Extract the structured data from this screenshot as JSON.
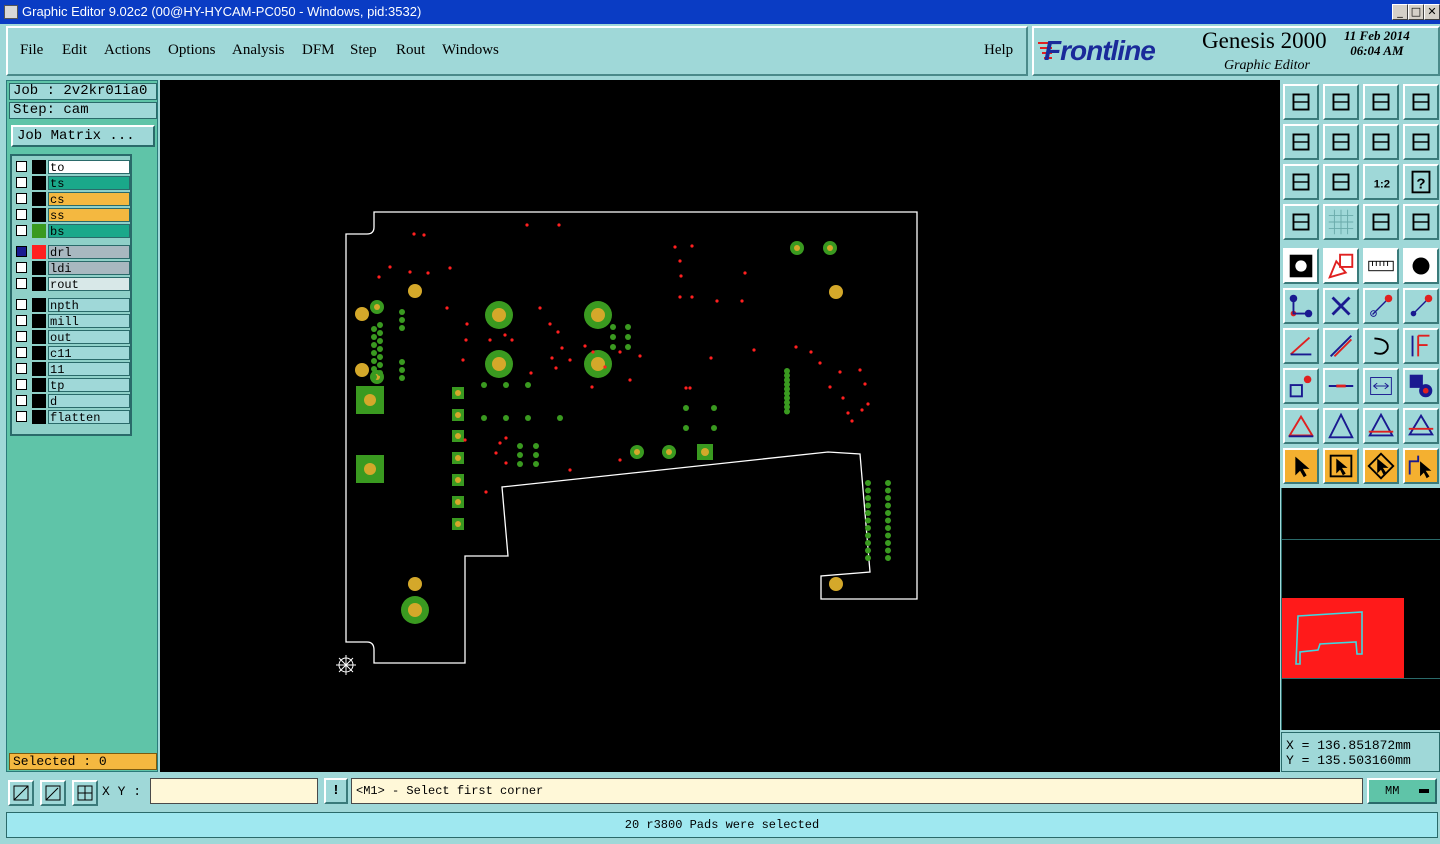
{
  "window": {
    "title": "Graphic Editor 9.02c2 (00@HY-HYCAM-PC050 - Windows, pid:3532)",
    "controls": [
      "_",
      "□",
      "✕"
    ]
  },
  "menu": {
    "items": [
      "File",
      "Edit",
      "Actions",
      "Options",
      "Analysis",
      "DFM",
      "Step",
      "Rout",
      "Windows"
    ],
    "help": "Help"
  },
  "brand": {
    "logo": "Frontline",
    "product": "Genesis 2000",
    "subtitle": "Graphic Editor",
    "date": "11 Feb 2014",
    "time": "06:04 AM"
  },
  "job": {
    "job_label": "Job : 2v2kr01ia0",
    "step_label": "Step: cam",
    "matrix_button": "Job Matrix ..."
  },
  "layers": [
    {
      "name": "to",
      "color": "#000000",
      "bg": "#ffffff",
      "checked": false
    },
    {
      "name": "ts",
      "color": "#000000",
      "bg": "#1aa88a",
      "checked": false
    },
    {
      "name": "cs",
      "color": "#000000",
      "bg": "#f4b840",
      "checked": false
    },
    {
      "name": "ss",
      "color": "#000000",
      "bg": "#f4b840",
      "checked": false
    },
    {
      "name": "bs",
      "color": "#3a9a20",
      "bg": "#1aa88a",
      "checked": false
    },
    {
      "name": "drl",
      "color": "#ff2020",
      "bg": "#a8b8c0",
      "checked": true
    },
    {
      "name": "ldi",
      "color": "#000000",
      "bg": "#a8b8c0",
      "checked": false
    },
    {
      "name": "rout",
      "color": "#000000",
      "bg": "#d8e8e8",
      "checked": false
    },
    {
      "name": "npth",
      "color": "#000000",
      "bg": "#9fd8d8",
      "checked": false
    },
    {
      "name": "mill",
      "color": "#000000",
      "bg": "#9fd8d8",
      "checked": false
    },
    {
      "name": "out",
      "color": "#000000",
      "bg": "#9fd8d8",
      "checked": false
    },
    {
      "name": "c11",
      "color": "#000000",
      "bg": "#9fd8d8",
      "checked": false
    },
    {
      "name": "11",
      "color": "#000000",
      "bg": "#9fd8d8",
      "checked": false
    },
    {
      "name": "tp",
      "color": "#000000",
      "bg": "#9fd8d8",
      "checked": false
    },
    {
      "name": "d",
      "color": "#000000",
      "bg": "#9fd8d8",
      "checked": false
    },
    {
      "name": "flatten",
      "color": "#000000",
      "bg": "#9fd8d8",
      "checked": false
    }
  ],
  "selected": "Selected : 0",
  "coords": {
    "x": "X = 136.851872mm",
    "y": "Y = 135.503160mm"
  },
  "cmd": {
    "xy_label": "X Y :",
    "xy_value": "",
    "warn": "!",
    "prompt": "<M1> - Select first corner",
    "units": "MM"
  },
  "status": "20 r3800 Pads were selected",
  "colors": {
    "board_outline": "#ffffff",
    "pad_green": "#3a9a20",
    "pad_gold": "#d4a82a",
    "drill": "#ff2020",
    "overview_bg": "#ff1a1a",
    "overview_outline": "#40d8e0"
  },
  "tools": [
    "zoom-home-icon",
    "zoom-out-icon",
    "home-view-icon",
    "zoom-window-icon",
    "pan-left-icon",
    "pan-right-icon",
    "undo-view-icon",
    "redraw-icon",
    "fit-all-icon",
    "fit-profile-icon",
    "one-to-one-icon",
    "help-query-icon",
    "measure-icon",
    "grid-icon",
    "snap-icon",
    "layer-compare-icon",
    "pad-icon",
    "shape-icon",
    "ruler-icon",
    "round-pad-icon",
    "connect-icon",
    "delete-node-icon",
    "add-line-icon",
    "move-node-icon",
    "angle-line-icon",
    "line-icon",
    "arc-icon",
    "split-icon",
    "node-icon",
    "cut-line-icon",
    "dimension-icon",
    "group-icon",
    "triangle-icon",
    "polygon-icon",
    "outline-icon",
    "fill-icon",
    "select-arrow-icon",
    "select-box-icon",
    "select-pointer-icon",
    "select-path-icon"
  ]
}
